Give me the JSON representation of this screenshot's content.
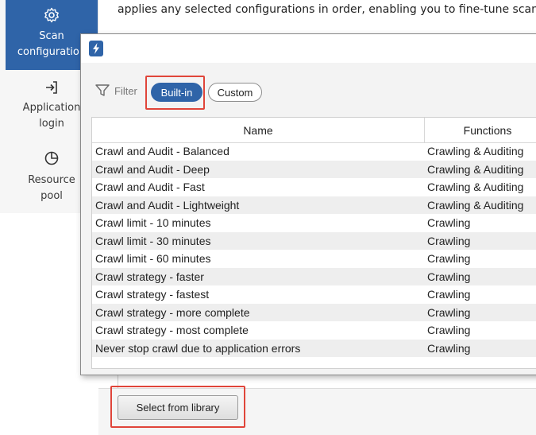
{
  "sidebar": {
    "items": [
      {
        "label": "Scan\nconfiguration",
        "icon": "gear-icon",
        "active": true
      },
      {
        "label": "Application\nlogin",
        "icon": "login-arrow-icon",
        "active": false
      },
      {
        "label": "Resource\npool",
        "icon": "pie-chart-icon",
        "active": false
      }
    ]
  },
  "main": {
    "description": "applies any selected configurations in order, enabling you to fine-tune scanning"
  },
  "dialog": {
    "app_icon": "lightning-icon",
    "filter": {
      "label": "Filter",
      "icon": "funnel-icon",
      "options": [
        "Built-in",
        "Custom"
      ],
      "selected": "Built-in"
    },
    "table": {
      "columns": [
        "Name",
        "Functions"
      ],
      "rows": [
        {
          "name": "Crawl and Audit - Balanced",
          "functions": "Crawling & Auditing"
        },
        {
          "name": "Crawl and Audit - Deep",
          "functions": "Crawling & Auditing"
        },
        {
          "name": "Crawl and Audit - Fast",
          "functions": "Crawling & Auditing"
        },
        {
          "name": "Crawl and Audit - Lightweight",
          "functions": "Crawling & Auditing"
        },
        {
          "name": "Crawl limit - 10 minutes",
          "functions": "Crawling"
        },
        {
          "name": "Crawl limit - 30 minutes",
          "functions": "Crawling"
        },
        {
          "name": "Crawl limit - 60 minutes",
          "functions": "Crawling"
        },
        {
          "name": "Crawl strategy - faster",
          "functions": "Crawling"
        },
        {
          "name": "Crawl strategy - fastest",
          "functions": "Crawling"
        },
        {
          "name": "Crawl strategy - more complete",
          "functions": "Crawling"
        },
        {
          "name": "Crawl strategy - most complete",
          "functions": "Crawling"
        },
        {
          "name": "Never stop crawl due to application errors",
          "functions": "Crawling"
        }
      ]
    }
  },
  "footer": {
    "select_button": "Select from library"
  },
  "colors": {
    "accent": "#2f64a8",
    "highlight": "#e0453a"
  }
}
